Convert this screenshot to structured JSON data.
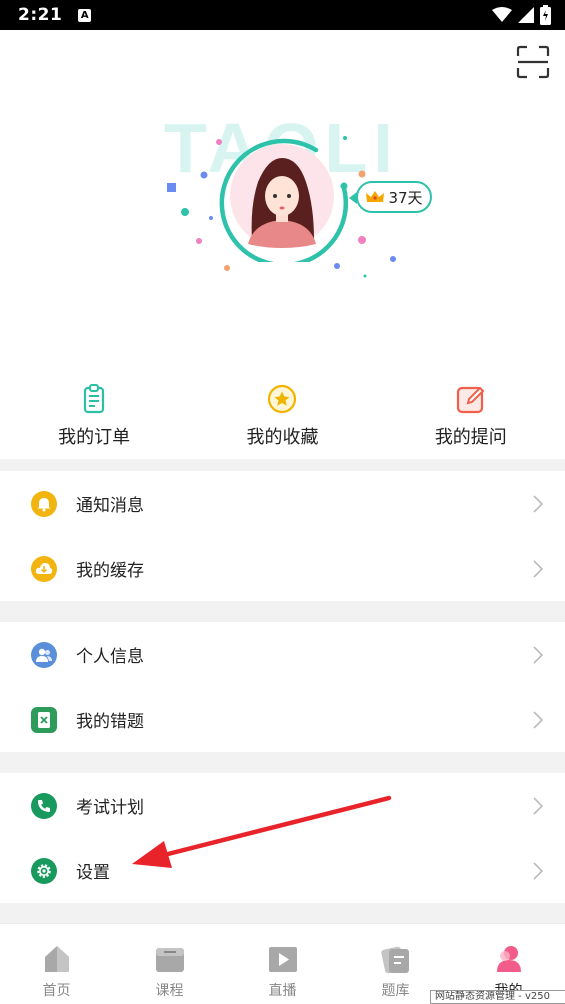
{
  "status_bar": {
    "time": "2:21",
    "notification": "A"
  },
  "header": {
    "watermark_text": "TAOLI",
    "vip_days": "37天"
  },
  "quick_actions": [
    {
      "label": "我的订单",
      "icon": "order-clipboard-icon",
      "color": "#2bbfa4"
    },
    {
      "label": "我的收藏",
      "icon": "favorite-star-icon",
      "color": "#f0b400"
    },
    {
      "label": "我的提问",
      "icon": "question-edit-icon",
      "color": "#f0604a"
    }
  ],
  "groups": [
    {
      "items": [
        {
          "label": "通知消息",
          "icon": "bell-icon",
          "color": "#f2b50f"
        },
        {
          "label": "我的缓存",
          "icon": "download-cloud-icon",
          "color": "#f2b50f"
        }
      ]
    },
    {
      "items": [
        {
          "label": "个人信息",
          "icon": "user-group-icon",
          "color": "#5b8fd9"
        },
        {
          "label": "我的错题",
          "icon": "wrong-question-icon",
          "color": "#2e9b5b"
        }
      ]
    },
    {
      "items": [
        {
          "label": "考试计划",
          "icon": "phone-icon",
          "color": "#189a5e"
        },
        {
          "label": "设置",
          "icon": "gear-icon",
          "color": "#189a5e"
        }
      ]
    }
  ],
  "bottom_nav": [
    {
      "label": "首页",
      "icon": "home-icon",
      "active": false
    },
    {
      "label": "课程",
      "icon": "course-icon",
      "active": false
    },
    {
      "label": "直播",
      "icon": "live-play-icon",
      "active": false
    },
    {
      "label": "题库",
      "icon": "question-bank-icon",
      "active": false
    },
    {
      "label": "我的",
      "icon": "profile-icon",
      "active": true
    }
  ],
  "overlay": {
    "watermark": "网站静态资源管理 - v250"
  },
  "colors": {
    "accent": "#2fc2aa",
    "annotation_arrow": "#e8232a",
    "divider": "#f2f2f2"
  }
}
